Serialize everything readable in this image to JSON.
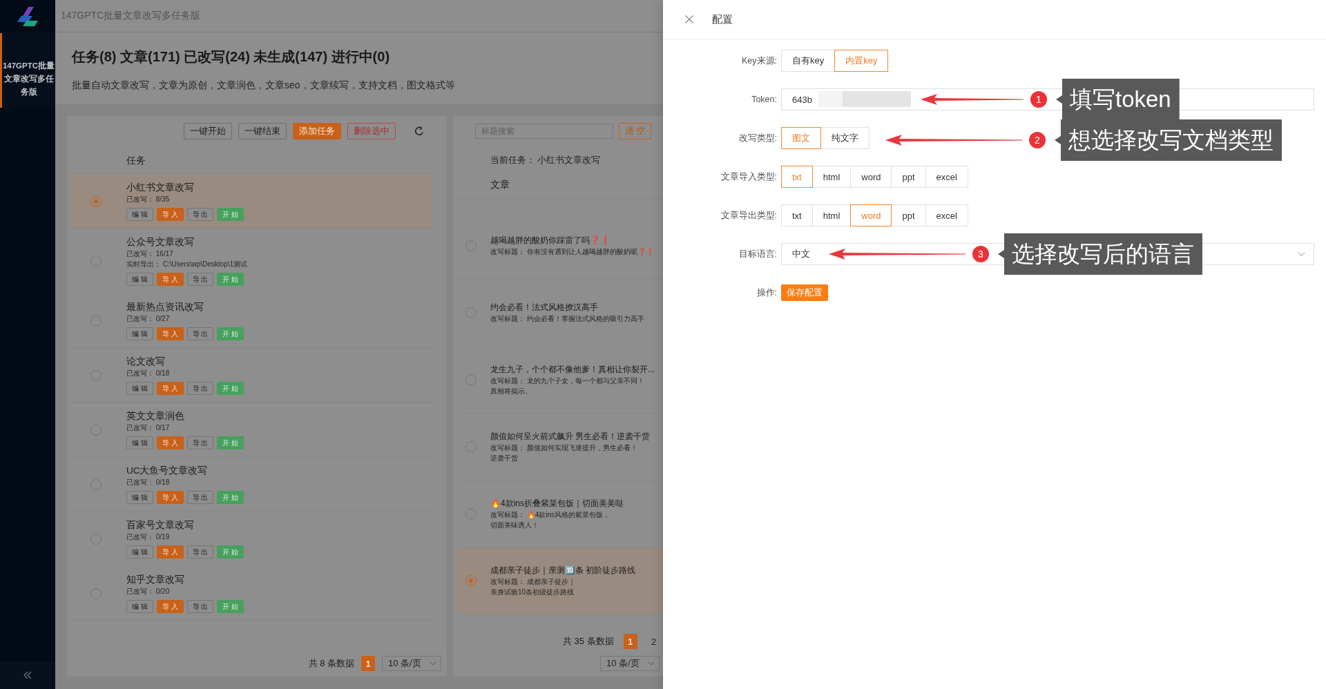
{
  "sidebar": {
    "items": [
      {
        "label": "147GPTC批量文章改写多任务版",
        "selected": true
      }
    ]
  },
  "header": {
    "title": "147GPTC批量文章改写多任务版"
  },
  "summary": {
    "title": "任务(8) 文章(171) 已改写(24) 未生成(147) 进行中(0)",
    "description": "批量自动文章改写，文章为原创，文章润色，文章seo，文章续写，支持文档，图文格式等"
  },
  "task_panel": {
    "toolbar": [
      {
        "label": "一键开始",
        "kind": "default"
      },
      {
        "label": "一键结束",
        "kind": "default"
      },
      {
        "label": "添加任务",
        "kind": "primary"
      },
      {
        "label": "删除选中",
        "kind": "danger"
      }
    ],
    "column": "任务",
    "tasks": [
      {
        "name": "小红书文章改写",
        "progress": "已改写： 8/35",
        "selected": true,
        "actions": [
          {
            "label": "编 辑",
            "kind": "default"
          },
          {
            "label": "导 入",
            "kind": "primary"
          },
          {
            "label": "导 出",
            "kind": "default"
          },
          {
            "label": "开 始",
            "kind": "success"
          }
        ]
      },
      {
        "name": "公众号文章改写",
        "progress": "已改写： 16/17",
        "export_path": "实时导出： C:\\Users\\wp\\Desktop\\1测试",
        "selected": false,
        "actions": [
          {
            "label": "编 辑",
            "kind": "default"
          },
          {
            "label": "导 入",
            "kind": "primary"
          },
          {
            "label": "导 出",
            "kind": "default"
          },
          {
            "label": "开 始",
            "kind": "success"
          }
        ]
      },
      {
        "name": "最新热点资讯改写",
        "progress": "已改写： 0/27",
        "selected": false,
        "actions": [
          {
            "label": "编 辑",
            "kind": "default"
          },
          {
            "label": "导 入",
            "kind": "primary"
          },
          {
            "label": "导 出",
            "kind": "default"
          },
          {
            "label": "开 始",
            "kind": "success"
          }
        ]
      },
      {
        "name": "论文改写",
        "progress": "已改写： 0/18",
        "selected": false,
        "actions": [
          {
            "label": "编 辑",
            "kind": "default"
          },
          {
            "label": "导 入",
            "kind": "primary"
          },
          {
            "label": "导 出",
            "kind": "default"
          },
          {
            "label": "开 始",
            "kind": "success"
          }
        ]
      },
      {
        "name": "英文文章润色",
        "progress": "已改写： 0/17",
        "selected": false,
        "actions": [
          {
            "label": "编 辑",
            "kind": "default"
          },
          {
            "label": "导 入",
            "kind": "primary"
          },
          {
            "label": "导 出",
            "kind": "default"
          },
          {
            "label": "开 始",
            "kind": "success"
          }
        ]
      },
      {
        "name": "UC大鱼号文章改写",
        "progress": "已改写： 0/18",
        "selected": false,
        "actions": [
          {
            "label": "编 辑",
            "kind": "default"
          },
          {
            "label": "导 入",
            "kind": "primary"
          },
          {
            "label": "导 出",
            "kind": "default"
          },
          {
            "label": "开 始",
            "kind": "success"
          }
        ]
      },
      {
        "name": "百家号文章改写",
        "progress": "已改写： 0/19",
        "selected": false,
        "actions": [
          {
            "label": "编 辑",
            "kind": "default"
          },
          {
            "label": "导 入",
            "kind": "primary"
          },
          {
            "label": "导 出",
            "kind": "default"
          },
          {
            "label": "开 始",
            "kind": "success"
          }
        ]
      },
      {
        "name": "知乎文章改写",
        "progress": "已改写： 0/20",
        "selected": false,
        "actions": [
          {
            "label": "编 辑",
            "kind": "default"
          },
          {
            "label": "导 入",
            "kind": "primary"
          },
          {
            "label": "导 出",
            "kind": "default"
          },
          {
            "label": "开 始",
            "kind": "success"
          }
        ]
      }
    ],
    "pagination": {
      "total": "共 8 条数据",
      "pages": [
        {
          "label": "1",
          "selected": true
        }
      ],
      "page_size": "10 条/页"
    }
  },
  "article_panel": {
    "search": {
      "placeholder": "标题搜索"
    },
    "clear_button": "清 空",
    "current_task": "当前任务： 小红书文章改写",
    "column": "文章",
    "articles": [
      {
        "title": "越喝越胖的酸奶你踩雷了吗❓❗",
        "rewritten": [
          "改写标题： 你有没有遇到让人越喝越胖的酸奶呢❓❗"
        ],
        "selected": false
      },
      {
        "title": "约会必看！法式风格撩汉高手",
        "rewritten": [
          "改写标题： 约会必看！掌握法式风格的吸引力高手"
        ],
        "selected": false
      },
      {
        "title": "龙生九子，个个都不像他爹！真相让你裂开...",
        "rewritten": [
          "改写标题： 龙的九个子女，每一个都与父亲不同！",
          "真相将揭示。"
        ],
        "selected": false
      },
      {
        "title": "颜值如何呈火箭式飙升 男生必看！逆袭干货",
        "rewritten": [
          "改写标题： 颜值如何实现飞速提升，男生必看！",
          "逆袭干货"
        ],
        "selected": false
      },
      {
        "title": "🔥4款ins折叠紫菜包饭｜切面美美哒",
        "rewritten": [
          "改写标题： 🔥4款ins风格的紫菜包饭，",
          "切面美味诱人！"
        ],
        "selected": false
      },
      {
        "title": "成都亲子徒步｜亲测🔟条 初阶徒步路线",
        "rewritten": [
          "改写标题： 成都亲子徒步｜",
          "亲身试验10条初级徒步路线"
        ],
        "selected": true
      }
    ],
    "pagination": {
      "total": "共 35 条数据",
      "pages": [
        {
          "label": "1",
          "selected": true
        },
        {
          "label": "2",
          "selected": false
        }
      ],
      "page_size": "10 条/页"
    }
  },
  "config_drawer": {
    "title": "配置",
    "fields": [
      {
        "kind": "segmented",
        "label": "Key来源:",
        "options": [
          {
            "label": "自有key",
            "selected": false
          },
          {
            "label": "内置key",
            "selected": true
          }
        ]
      },
      {
        "kind": "input",
        "label": "Token:",
        "value": "643b",
        "redacted": true,
        "annotation": {
          "number": "1",
          "text": "填写token"
        }
      },
      {
        "kind": "segmented",
        "label": "改写类型:",
        "options": [
          {
            "label": "图文",
            "selected": true
          },
          {
            "label": "纯文字",
            "selected": false
          }
        ],
        "annotation": {
          "number": "2",
          "text": "想选择改写文档类型"
        }
      },
      {
        "kind": "segmented",
        "label": "文章导入类型:",
        "options": [
          {
            "label": "txt",
            "selected": true
          },
          {
            "label": "html",
            "selected": false
          },
          {
            "label": "word",
            "selected": false
          },
          {
            "label": "ppt",
            "selected": false
          },
          {
            "label": "excel",
            "selected": false
          }
        ]
      },
      {
        "kind": "segmented",
        "label": "文章导出类型:",
        "options": [
          {
            "label": "txt",
            "selected": false
          },
          {
            "label": "html",
            "selected": false
          },
          {
            "label": "word",
            "selected": true
          },
          {
            "label": "ppt",
            "selected": false
          },
          {
            "label": "excel",
            "selected": false
          }
        ]
      },
      {
        "kind": "select",
        "label": "目标语言:",
        "value": "中文",
        "annotation": {
          "number": "3",
          "text": "选择改写后的语言"
        }
      },
      {
        "kind": "button",
        "label": "操作:",
        "button": "保存配置"
      }
    ]
  }
}
